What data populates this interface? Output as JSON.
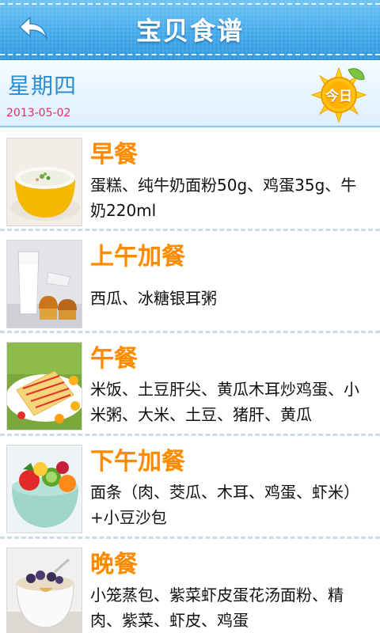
{
  "header": {
    "title": "宝贝食谱",
    "back_icon": "back-arrow-icon"
  },
  "date_bar": {
    "weekday": "星期四",
    "date": "2013-05-02",
    "today_label": "今日",
    "today_icon": "sun-icon"
  },
  "colors": {
    "header_blue": "#42a9ea",
    "meal_name_orange": "#ff8a00",
    "date_pink": "#e0306a",
    "weekday_blue": "#2a8fd6"
  },
  "meals": [
    {
      "name": "早餐",
      "description": "蛋糕、纯牛奶面粉50g、鸡蛋35g、牛奶220ml",
      "image": "porridge-bowl-photo"
    },
    {
      "name": "上午加餐",
      "description": "西瓜、冰糖银耳粥",
      "image": "milk-and-muffins-photo"
    },
    {
      "name": "午餐",
      "description": "米饭、土豆肝尖、黄瓜木耳炒鸡蛋、小米粥、大米、土豆、猪肝、黄瓜",
      "image": "omelette-plate-photo"
    },
    {
      "name": "下午加餐",
      "description": "面条（肉、茭瓜、木耳、鸡蛋、虾米）+小豆沙包",
      "image": "fruit-salad-bowl-photo"
    },
    {
      "name": "晚餐",
      "description": "小笼蒸包、紫菜虾皮蛋花汤面粉、精肉、紫菜、虾皮、鸡蛋",
      "image": "dessert-cup-photo"
    }
  ]
}
